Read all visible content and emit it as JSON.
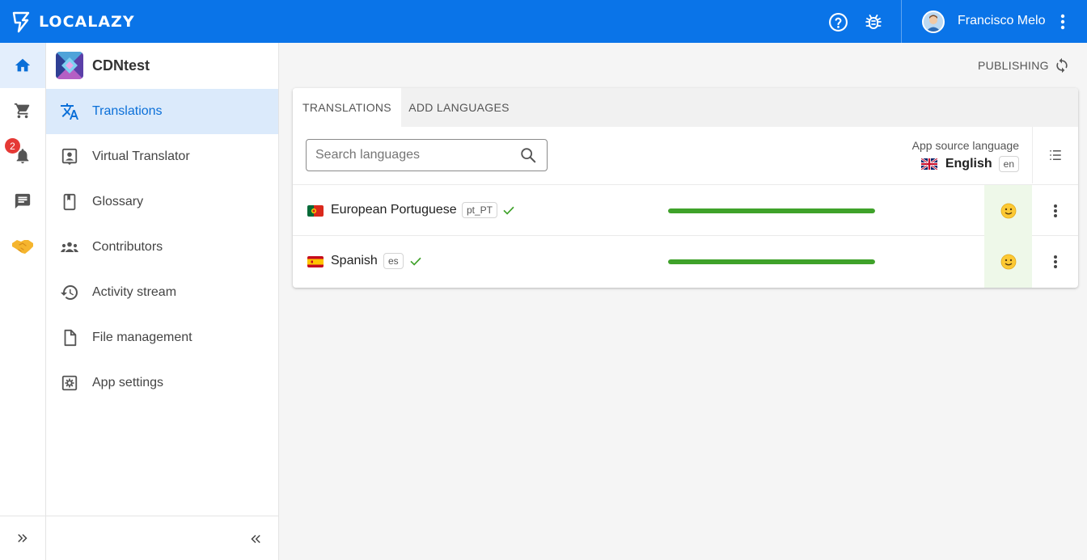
{
  "brand": {
    "name": "LOCALAZY",
    "color": "#0a74e8"
  },
  "topbar": {
    "help_icon": "help-circle-icon",
    "bug_icon": "bug-icon",
    "user_name": "Francisco Melo"
  },
  "rail": {
    "items": [
      "home-icon",
      "cart-icon",
      "bell-icon",
      "chat-icon",
      "handshake-icon"
    ],
    "notification_count": "2"
  },
  "app": {
    "name": "CDNtest"
  },
  "nav": {
    "items": [
      {
        "label": "Translations",
        "icon": "translate-icon",
        "active": true
      },
      {
        "label": "Virtual Translator",
        "icon": "virtual-translator-icon"
      },
      {
        "label": "Glossary",
        "icon": "book-icon"
      },
      {
        "label": "Contributors",
        "icon": "people-icon"
      },
      {
        "label": "Activity stream",
        "icon": "history-icon"
      },
      {
        "label": "File management",
        "icon": "file-icon"
      },
      {
        "label": "App settings",
        "icon": "settings-icon"
      }
    ]
  },
  "main": {
    "publishing_label": "PUBLISHING",
    "tabs": [
      "TRANSLATIONS",
      "ADD LANGUAGES"
    ],
    "search_placeholder": "Search languages",
    "source": {
      "label": "App source language",
      "language": "English",
      "code": "en"
    },
    "languages": [
      {
        "name": "European Portuguese",
        "code": "pt_PT",
        "progress": 1.0
      },
      {
        "name": "Spanish",
        "code": "es",
        "progress": 1.0
      }
    ],
    "progress_color": "#3fa22a"
  }
}
